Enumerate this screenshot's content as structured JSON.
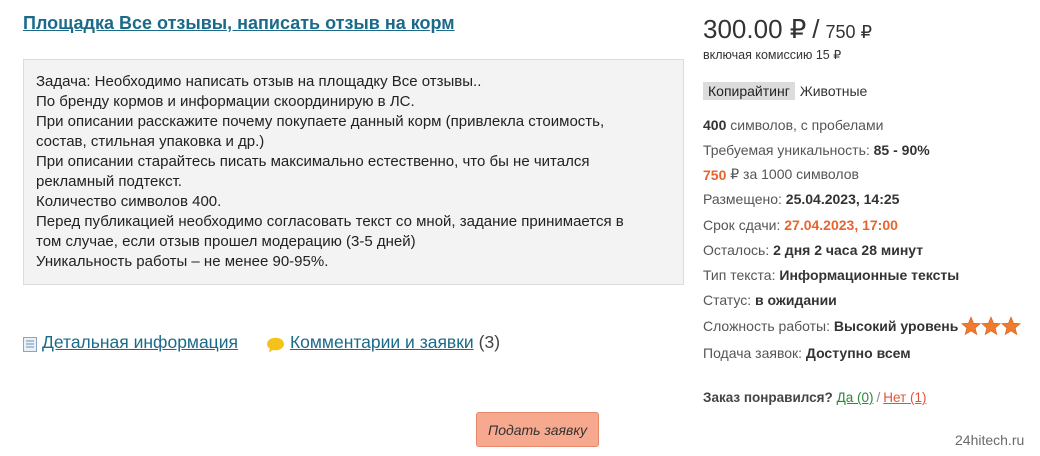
{
  "task": {
    "title": "Площадка Все отзывы, написать отзыв на корм",
    "lines": [
      "Задача: Необходимо написать отзыв на площадку Все отзывы..",
      "По бренду кормов и информации скоординирую в ЛС.",
      "При описании расскажите почему покупаете данный корм (привлекла стоимость,",
      "состав, стильная упаковка и др.)",
      "При описании старайтесь писать максимально естественно, что бы не читался",
      "рекламный подтекст.",
      "Количество символов 400.",
      "Перед публикацией необходимо согласовать текст со мной, задание принимается в",
      "том случае, если отзыв прошел модерацию (3-5 дней)",
      "Уникальность работы – не менее 90-95%."
    ]
  },
  "tabs": {
    "details_label": "Детальная информация",
    "comments_label": "Комментарии и заявки",
    "comments_count": "(3)"
  },
  "apply_button": "Подать заявку",
  "price": {
    "main": "300.00 ₽",
    "slash": "/",
    "total": "750 ₽",
    "commission": "включая комиссию 15 ₽"
  },
  "tags": {
    "category": "Копирайтинг",
    "subcategory": "Животные"
  },
  "info": {
    "chars_value": "400",
    "chars_text": " символов, с пробелами",
    "uniqueness_label": "Требуемая уникальность: ",
    "uniqueness_value": "85 - 90%",
    "rate_value": "750",
    "rate_text": " ₽ за 1000 символов",
    "posted_label": "Размещено: ",
    "posted_value": "25.04.2023, 14:25",
    "deadline_label": "Срок сдачи: ",
    "deadline_value": "27.04.2023, 17:00",
    "remaining_label": "Осталось: ",
    "remaining_value": "2 дня 2 часа 28 минут",
    "type_label": "Тип текста: ",
    "type_value": "Информационные тексты",
    "status_label": "Статус: ",
    "status_value": "в ожидании",
    "difficulty_label": "Сложность работы: ",
    "difficulty_value": "Высокий уровень",
    "difficulty_stars": 3,
    "applications_label": "Подача заявок: ",
    "applications_value": "Доступно всем"
  },
  "liked": {
    "label": "Заказ понравился?",
    "yes": "Да (0)",
    "sep": "/",
    "no": "Нет (1)"
  },
  "watermark": "24hitech.ru",
  "colors": {
    "link": "#1b6a8a",
    "accent_orange": "#e8642e",
    "button_bg": "#f6a98f",
    "star": "#f07a2e"
  }
}
